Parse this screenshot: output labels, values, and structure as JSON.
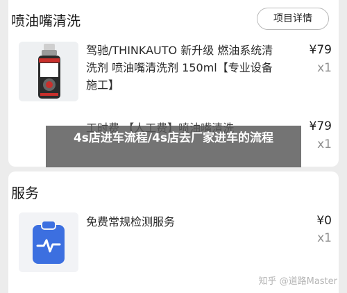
{
  "section1": {
    "title": "喷油嘴清洗",
    "detail_button": "项目详情",
    "items": [
      {
        "name": "驾驰/THINKAUTO 新升级 燃油系统清洗剂 喷油嘴清洗剂 150ml【专业设备施工】",
        "price": "¥79",
        "qty": "x1",
        "image_icon": "fuel-cleaner-bottle-icon"
      },
      {
        "name": "工时费 【人工费】喷油嘴清洗",
        "price": "¥79",
        "qty": "x1"
      }
    ]
  },
  "banner": {
    "text": "4s店进车流程/4s店去厂家进车的流程"
  },
  "section2": {
    "title": "服务",
    "items": [
      {
        "name": "免费常规检测服务",
        "price": "¥0",
        "qty": "x1",
        "image_icon": "clipboard-pulse-icon"
      }
    ]
  },
  "watermark": "知乎 @道路Master",
  "colors": {
    "background": "#ececec",
    "card": "#ffffff",
    "accent_blue": "#3c6fe0",
    "muted": "#8f8f8f"
  }
}
